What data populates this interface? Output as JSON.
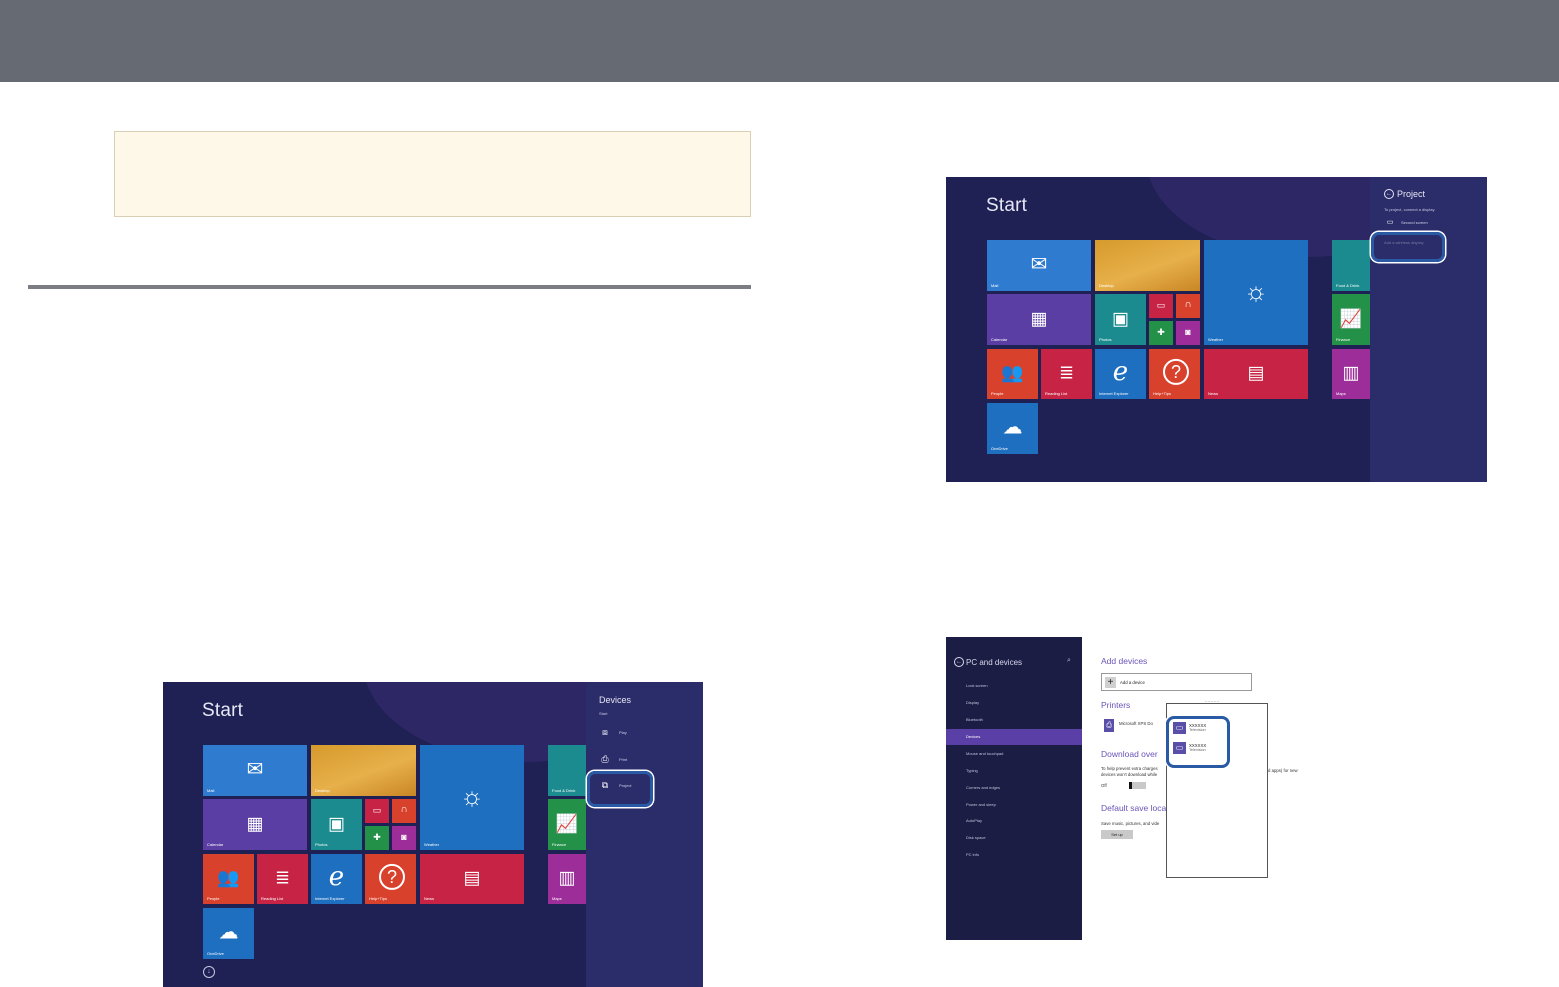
{
  "screenshot_start_devices": {
    "start_label": "Start",
    "tiles": {
      "mail": "Mail",
      "desktop": "Desktop",
      "weather": "Weather",
      "calendar": "Calendar",
      "photos": "Photos",
      "people": "People",
      "reading_list": "Reading List",
      "internet_explorer": "Internet Explorer",
      "help_tips": "Help+Tips",
      "news": "News",
      "onedrive": "OneDrive",
      "food_drink": "Food & Drink",
      "finance": "Finance",
      "maps": "Maps"
    },
    "charm": {
      "title": "Devices",
      "subtitle": "Start",
      "items": [
        "Play",
        "Print",
        "Project"
      ]
    }
  },
  "screenshot_start_project": {
    "start_label": "Start",
    "charm": {
      "title": "Project",
      "subtitle": "To project, connect a display.",
      "item_second_screen": "Second screen",
      "item_add_wireless": "Add a wireless display"
    }
  },
  "screenshot_pc_devices": {
    "title": "PC and devices",
    "nav": [
      "Lock screen",
      "Display",
      "Bluetooth",
      "Devices",
      "Mouse and touchpad",
      "Typing",
      "Corners and edges",
      "Power and sleep",
      "AutoPlay",
      "Disk space",
      "PC info"
    ],
    "selected_nav": "Devices",
    "add_devices_heading": "Add devices",
    "add_device_label": "Add a device",
    "printers_heading": "Printers",
    "printer_name": "Microsoft XPS Do",
    "download_heading": "Download over",
    "download_text_1": "To help prevent extra charges",
    "download_text_2": "devices won't download while",
    "download_text_right": "d apps) for new",
    "toggle_value": "Off",
    "save_heading": "Default save loca",
    "save_text": "Save music, pictures, and vide",
    "setup_label": "Set up",
    "found_devices": [
      {
        "name": "XXXXXX",
        "type": "Television"
      },
      {
        "name": "XXXXXX",
        "type": "Television"
      }
    ]
  },
  "colors": {
    "top_bar": "#666b73",
    "note_background": "#fef8e8",
    "start_background": "#1f2054",
    "highlight": "#2a5aa4"
  }
}
